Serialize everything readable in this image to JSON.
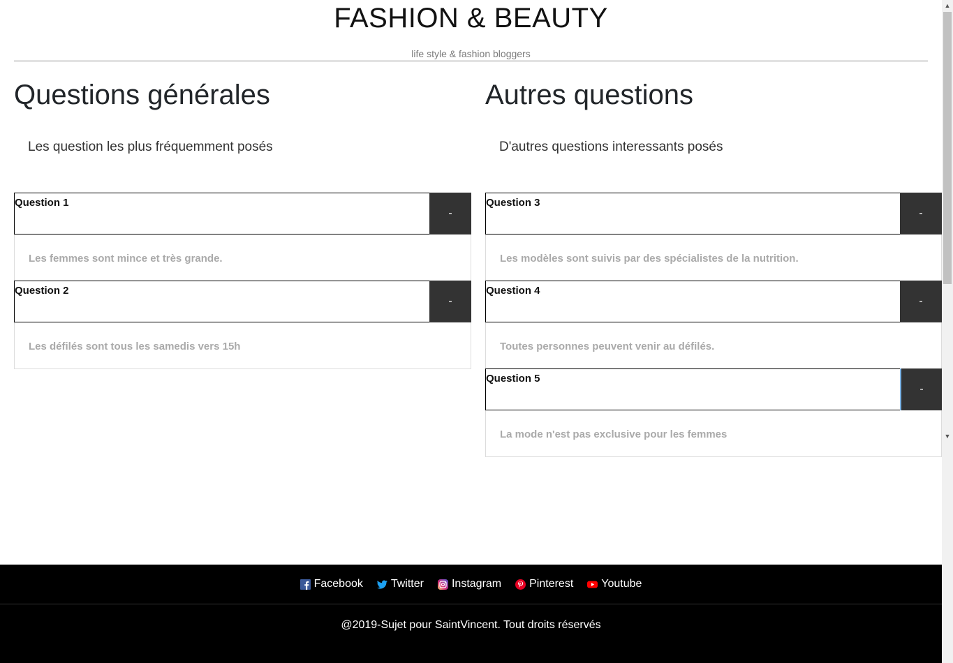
{
  "header": {
    "title": "FASHION & BEAUTY",
    "subtitle": "life style & fashion bloggers"
  },
  "left": {
    "heading": "Questions générales",
    "intro": "Les question les plus fréquemment posés",
    "items": [
      {
        "question": "Question 1",
        "toggle": "-",
        "answer": "Les femmes sont mince et très grande."
      },
      {
        "question": "Question 2",
        "toggle": "-",
        "answer": "Les défilés sont tous les samedis vers 15h"
      }
    ]
  },
  "right": {
    "heading": "Autres questions",
    "intro": "D'autres questions interessants posés",
    "items": [
      {
        "question": "Question 3",
        "toggle": "-",
        "answer": "Les modèles sont suivis par des spécialistes de la nutrition."
      },
      {
        "question": "Question 4",
        "toggle": "-",
        "answer": "Toutes personnes peuvent venir au défilés."
      },
      {
        "question": "Question 5",
        "toggle": "-",
        "answer": "La mode n'est pas exclusive pour les femmes"
      }
    ]
  },
  "footer": {
    "social": [
      {
        "label": "Facebook",
        "icon": "facebook-icon",
        "color": "#3b5998"
      },
      {
        "label": "Twitter",
        "icon": "twitter-icon",
        "color": "#1da1f2"
      },
      {
        "label": "Instagram",
        "icon": "instagram-icon",
        "color": "#c13584"
      },
      {
        "label": "Pinterest",
        "icon": "pinterest-icon",
        "color": "#e60023"
      },
      {
        "label": "Youtube",
        "icon": "youtube-icon",
        "color": "#ff0000"
      }
    ],
    "copyright": "@2019-Sujet pour SaintVincent. Tout droits réservés"
  },
  "scrollbar": {
    "up_glyph": "▲",
    "down_glyph": "▼"
  }
}
